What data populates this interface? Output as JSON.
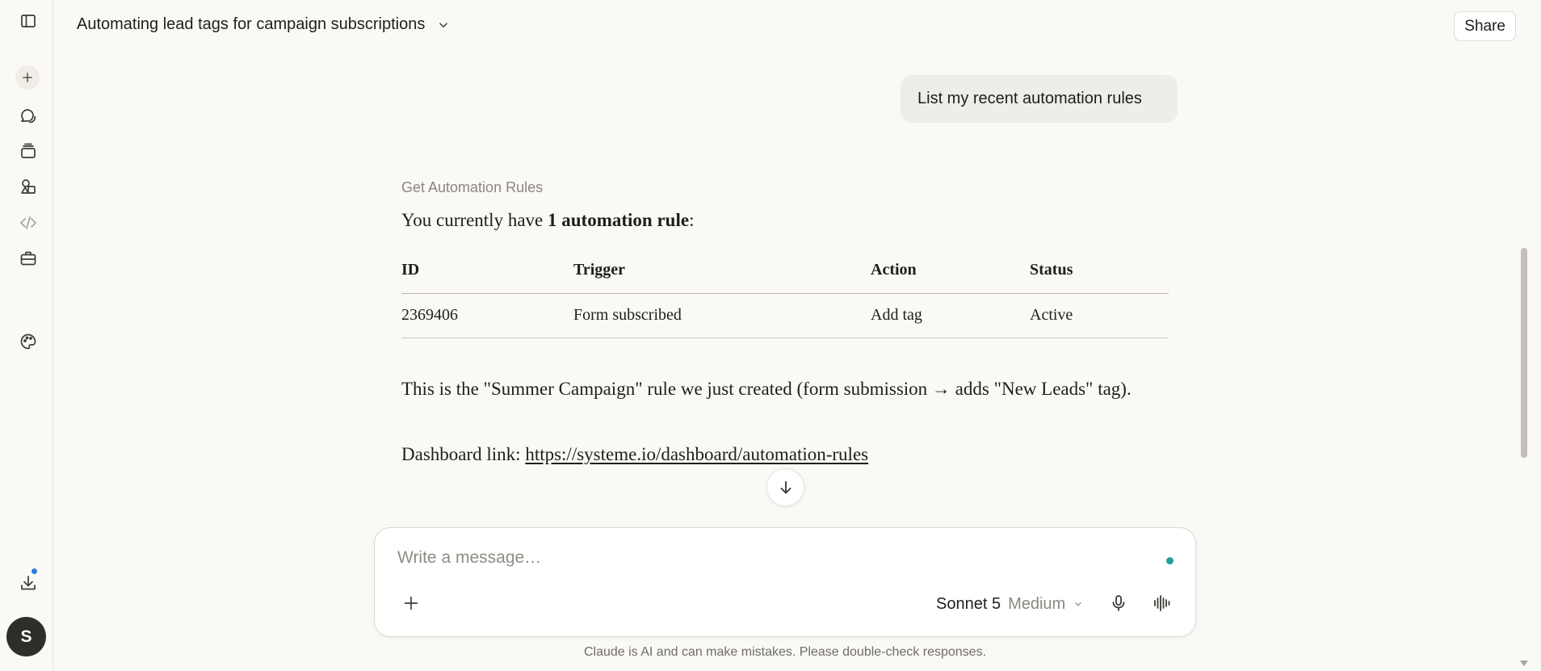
{
  "sidebar": {
    "items": [
      {
        "name": "sidebar-toggle-icon"
      },
      {
        "name": "new-chat-icon"
      },
      {
        "name": "chats-icon"
      },
      {
        "name": "projects-icon"
      },
      {
        "name": "artifacts-icon"
      },
      {
        "name": "code-icon"
      },
      {
        "name": "toolbox-icon"
      },
      {
        "name": "palette-icon"
      },
      {
        "name": "download-icon"
      }
    ],
    "avatar_initial": "S"
  },
  "header": {
    "title": "Automating lead tags for campaign subscriptions",
    "share_label": "Share"
  },
  "conversation": {
    "user_message": "List my recent automation rules",
    "tool_label": "Get Automation Rules",
    "intro_prefix": "You currently have ",
    "intro_bold": "1 automation rule",
    "intro_suffix": ":",
    "table": {
      "headers": [
        "ID",
        "Trigger",
        "Action",
        "Status"
      ],
      "rows": [
        [
          "2369406",
          "Form subscribed",
          "Add tag",
          "Active"
        ]
      ]
    },
    "note": "This is the \"Summer Campaign\" rule we just created (form submission → adds \"New Leads\" tag).",
    "dashboard_prefix": "Dashboard link: ",
    "dashboard_link": "https://systeme.io/dashboard/automation-rules"
  },
  "composer": {
    "placeholder": "Write a message…",
    "model_name": "Sonnet 5",
    "model_effort": "Medium"
  },
  "disclaimer": "Claude is AI and can make mistakes. Please double-check responses.",
  "colors": {
    "background": "#FAF9F5",
    "status_dot": "#1FA09A",
    "notification": "#2E7DE1"
  }
}
